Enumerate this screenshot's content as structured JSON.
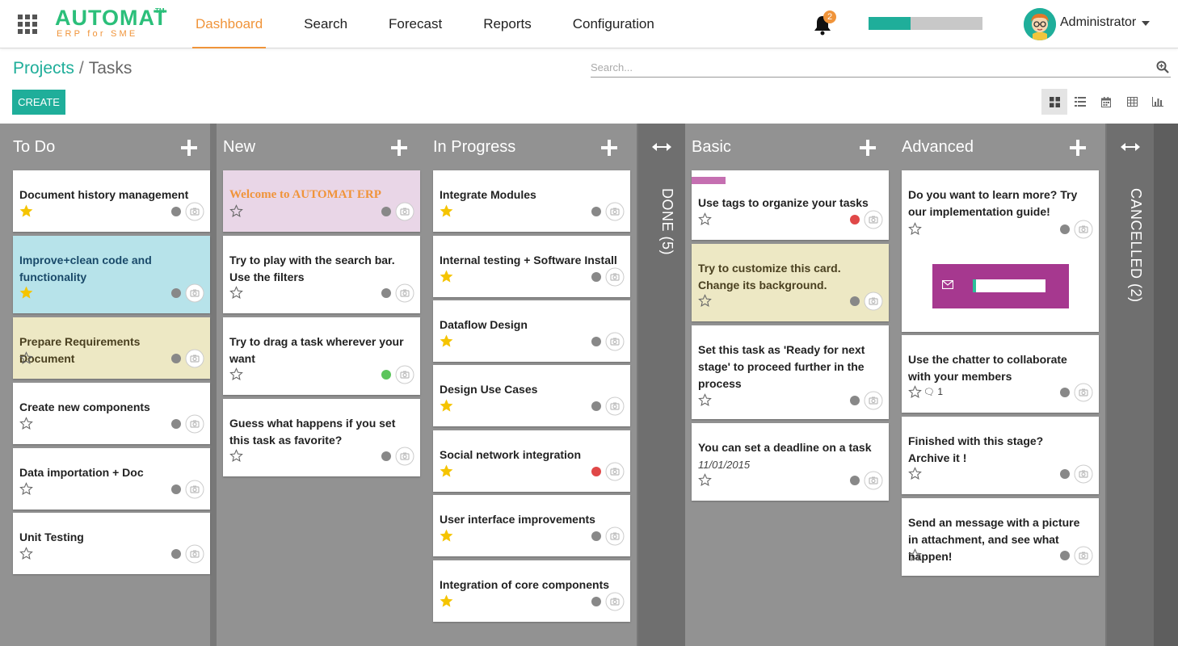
{
  "navbar": {
    "logo": {
      "main": "AUTOMAT",
      "tm": "TM",
      "sub": "ERP for SME"
    },
    "menu": [
      {
        "label": "Dashboard",
        "active": true
      },
      {
        "label": "Search",
        "active": false
      },
      {
        "label": "Forecast",
        "active": false
      },
      {
        "label": "Reports",
        "active": false
      },
      {
        "label": "Configuration",
        "active": false
      }
    ],
    "notifications_count": "2",
    "progress_fraction": 0.37,
    "user_name": "Administrator",
    "icons": {
      "apps": "apps-grid-icon",
      "bell": "bell-icon",
      "caret": "caret-down-icon"
    }
  },
  "breadcrumb": {
    "parent": "Projects",
    "separator": "/",
    "current": "Tasks"
  },
  "search": {
    "placeholder": "Search...",
    "icon": "search-icon"
  },
  "create_label": "CREATE",
  "views": [
    {
      "name": "kanban-view-icon",
      "active": true
    },
    {
      "name": "list-view-icon",
      "active": false
    },
    {
      "name": "calendar-view-icon",
      "active": false
    },
    {
      "name": "pivot-view-icon",
      "active": false
    },
    {
      "name": "graph-view-icon",
      "active": false
    }
  ],
  "colors": {
    "brand_green": "#2bbf7a",
    "brand_orange": "#f0943a",
    "teal": "#1fae9a",
    "card_blue": "#b7e3ea",
    "card_yellow": "#ede8c4",
    "card_pink": "#e9d6e7",
    "tag_pink": "#c56fb1",
    "dot_red": "#e04848",
    "dot_green": "#5cc55c",
    "promo_purple": "#a6388f"
  },
  "columns": {
    "todo": {
      "title": "To Do",
      "cards": [
        {
          "title": "Document history management",
          "starred": true
        },
        {
          "title": "Improve+clean code and functionality",
          "starred": true,
          "color": "blue"
        },
        {
          "title": "Prepare Requirements Document",
          "starred": false,
          "color": "yellow"
        },
        {
          "title": "Create new components",
          "starred": false
        },
        {
          "title": "Data importation + Doc",
          "starred": false
        },
        {
          "title": "Unit Testing",
          "starred": false
        }
      ]
    },
    "new": {
      "title": "New",
      "cards": [
        {
          "title": "Welcome to AUTOMAT ERP",
          "starred": false,
          "color": "pink"
        },
        {
          "title": "Try to play with the search bar. Use the filters",
          "starred": false
        },
        {
          "title": "Try to drag a task wherever your want",
          "starred": false,
          "dot": "green"
        },
        {
          "title": "Guess what happens if you set this task as favorite?",
          "starred": false
        }
      ]
    },
    "inprogress": {
      "title": "In Progress",
      "cards": [
        {
          "title": "Integrate Modules",
          "starred": true
        },
        {
          "title": "Internal testing + Software Install",
          "starred": true
        },
        {
          "title": "Dataflow Design",
          "starred": true
        },
        {
          "title": "Design Use Cases",
          "starred": true
        },
        {
          "title": "Social network integration",
          "starred": true,
          "dot": "red"
        },
        {
          "title": "User interface improvements",
          "starred": true
        },
        {
          "title": "Integration of core components",
          "starred": true
        }
      ]
    },
    "done": {
      "title": "DONE (5)"
    },
    "basic": {
      "title": "Basic",
      "cards": [
        {
          "title": "Use tags to organize your tasks",
          "starred": false,
          "dot": "red",
          "tag": true
        },
        {
          "title": "Try to customize this card. Change its background.",
          "starred": false,
          "color": "yellow"
        },
        {
          "title": "Set this task as 'Ready for next stage' to proceed further in the process",
          "starred": false
        },
        {
          "title": "You can set a deadline on a task",
          "date": "11/01/2015",
          "starred": false
        }
      ]
    },
    "advanced": {
      "title": "Advanced",
      "cards": [
        {
          "title": "Do you want to learn more? Try our implementation guide!",
          "starred": false,
          "promo": true
        },
        {
          "title": "Use the chatter to collaborate with your members",
          "starred": false,
          "messages": "1"
        },
        {
          "title": "Finished with this stage? Archive it !",
          "starred": false
        },
        {
          "title": "Send an message with a picture in attachment, and see what happen!",
          "starred": false
        }
      ]
    },
    "cancelled": {
      "title": "CANCELLED (2)"
    }
  }
}
